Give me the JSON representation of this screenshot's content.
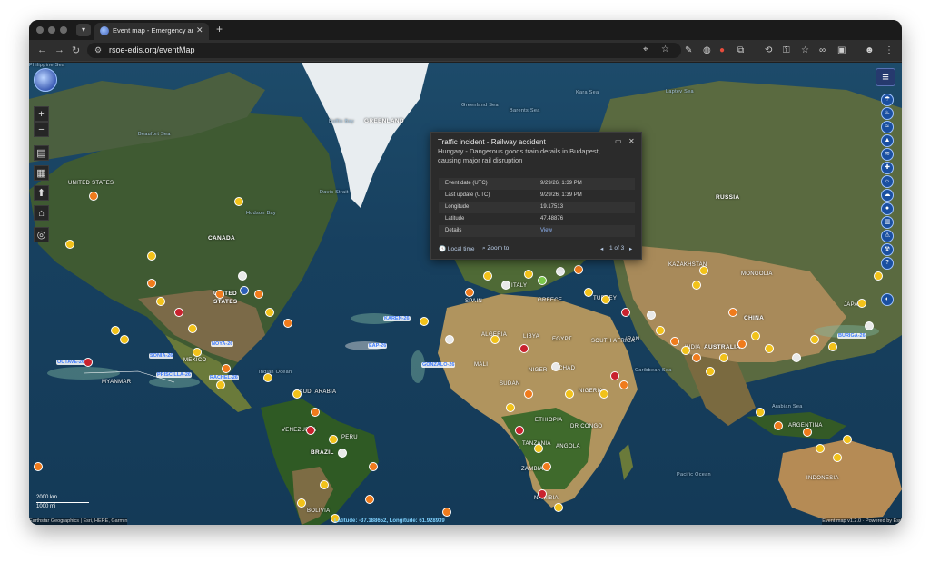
{
  "browser": {
    "tab_title": "Event map - Emergency and Di",
    "url": "rsoe-edis.org/eventMap"
  },
  "map": {
    "labels": [
      {
        "text": "GREENLAND",
        "cls": "lg"
      },
      {
        "text": "UNITED STATES",
        "cls": ""
      },
      {
        "text": "CANADA",
        "cls": "lg"
      },
      {
        "text": "UNITED",
        "cls": "lg"
      },
      {
        "text": "STATES",
        "cls": "lg"
      },
      {
        "text": "MEXICO",
        "cls": ""
      },
      {
        "text": "Hudson Bay",
        "cls": "sea"
      },
      {
        "text": "Baffin Bay",
        "cls": "sea"
      },
      {
        "text": "Davis Strait",
        "cls": "sea"
      },
      {
        "text": "Beaufort Sea",
        "cls": "sea"
      },
      {
        "text": "Greenland Sea",
        "cls": "sea"
      },
      {
        "text": "Kara Sea",
        "cls": "sea"
      },
      {
        "text": "Laptev Sea",
        "cls": "sea"
      },
      {
        "text": "Barents Sea",
        "cls": "sea"
      },
      {
        "text": "RUSSIA",
        "cls": "lg"
      },
      {
        "text": "KAZAKHSTAN",
        "cls": ""
      },
      {
        "text": "MONGOLIA",
        "cls": ""
      },
      {
        "text": "CHINA",
        "cls": "lg"
      },
      {
        "text": "JAPAN",
        "cls": ""
      },
      {
        "text": "INDIA",
        "cls": ""
      },
      {
        "text": "IRAN",
        "cls": ""
      },
      {
        "text": "TURKEY",
        "cls": ""
      },
      {
        "text": "SPAIN",
        "cls": ""
      },
      {
        "text": "ITALY",
        "cls": ""
      },
      {
        "text": "GREECE",
        "cls": ""
      },
      {
        "text": "ALGERIA",
        "cls": ""
      },
      {
        "text": "LIBYA",
        "cls": ""
      },
      {
        "text": "EGYPT",
        "cls": ""
      },
      {
        "text": "MALI",
        "cls": ""
      },
      {
        "text": "NIGER",
        "cls": ""
      },
      {
        "text": "CHAD",
        "cls": ""
      },
      {
        "text": "SUDAN",
        "cls": ""
      },
      {
        "text": "NIGERIA",
        "cls": ""
      },
      {
        "text": "ETHIOPIA",
        "cls": ""
      },
      {
        "text": "DR CONGO",
        "cls": ""
      },
      {
        "text": "TANZANIA",
        "cls": ""
      },
      {
        "text": "ANGOLA",
        "cls": ""
      },
      {
        "text": "ZAMBIA",
        "cls": ""
      },
      {
        "text": "NAMIBIA",
        "cls": ""
      },
      {
        "text": "SOUTH AFRICA",
        "cls": ""
      },
      {
        "text": "SAUDI ARABIA",
        "cls": ""
      },
      {
        "text": "VENEZUELA",
        "cls": ""
      },
      {
        "text": "PERU",
        "cls": ""
      },
      {
        "text": "BRAZIL",
        "cls": "lg"
      },
      {
        "text": "BOLIVIA",
        "cls": ""
      },
      {
        "text": "ARGENTINA",
        "cls": ""
      },
      {
        "text": "INDONESIA",
        "cls": ""
      },
      {
        "text": "AUSTRALIA",
        "cls": "lg"
      },
      {
        "text": "MYANMAR",
        "cls": ""
      },
      {
        "text": "Pacific Ocean",
        "cls": "sea"
      },
      {
        "text": "Indian Ocean",
        "cls": "sea"
      },
      {
        "text": "Caribbean Sea",
        "cls": "sea"
      },
      {
        "text": "Arabian Sea",
        "cls": "sea"
      },
      {
        "text": "Philippine Sea",
        "cls": "sea"
      }
    ],
    "storms": [
      "OCTAVE-26",
      "SONIA-26",
      "PRISCILLA-26",
      "RACHEL-26",
      "GONZALO-26",
      "KAREN-26",
      "EAP-26",
      "NOYA-26",
      "BURIGA-26"
    ],
    "scale": {
      "km": "2000 km",
      "mi": "1000 mi"
    },
    "attribution": "Earthstar Geographics | Esri, HERE, Garmin",
    "coordinates": "Latitude: -37.188652, Longitude: 61.928939",
    "version": "Event map v1.2.0 · Powered by Esri"
  },
  "popup": {
    "title": "Traffic incident - Railway accident",
    "subtitle": "Hungary - Dangerous goods train derails in Budapest, causing major rail disruption",
    "rows": [
      {
        "key": "Event date (UTC)",
        "value": "9/29/26, 1:39 PM"
      },
      {
        "key": "Last update (UTC)",
        "value": "9/29/26, 1:39 PM"
      },
      {
        "key": "Longitude",
        "value": "19.17513"
      },
      {
        "key": "Latitude",
        "value": "47.48876"
      },
      {
        "key": "Details",
        "value": "View"
      }
    ],
    "local_time": "Local time",
    "zoom_to": "Zoom to",
    "pager": "1 of 3"
  },
  "icons": {
    "zoom_in": "+",
    "zoom_out": "−",
    "menu": "≡",
    "left_tools": [
      "calendar-icon",
      "grid-icon",
      "compass-icon",
      "home-icon",
      "locate-icon"
    ],
    "layer_buttons": [
      "storm-icon",
      "fire-icon",
      "flood-icon",
      "volcano-icon",
      "earthquake-icon",
      "health-icon",
      "sun-icon",
      "weather-icon",
      "drop-icon",
      "building-icon",
      "hazard-icon",
      "radiation-icon",
      "help-icon"
    ]
  },
  "colors": {
    "marker_yellow": "#f2c21a",
    "marker_orange": "#f07b1c",
    "marker_red": "#c9222e",
    "storm_label": "#3d7bff",
    "popup_link": "#8fb4f5"
  }
}
